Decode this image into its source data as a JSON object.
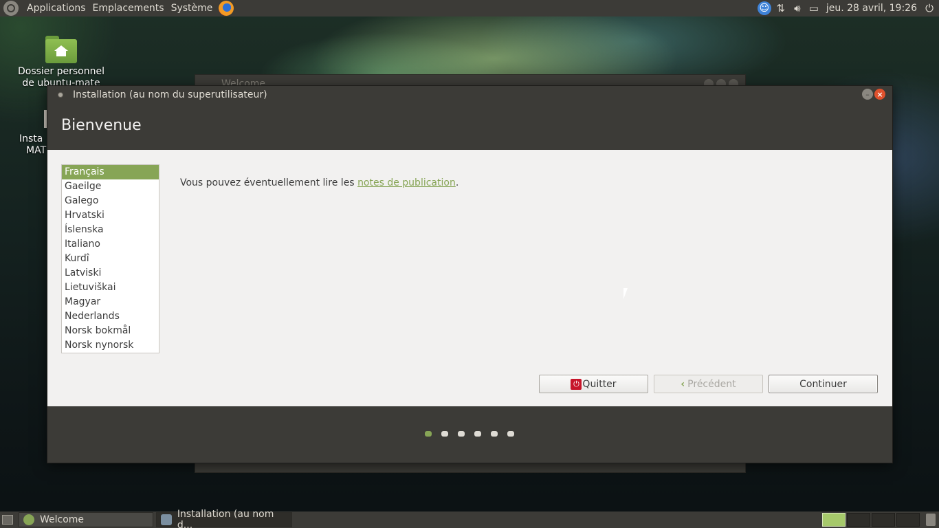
{
  "top_panel": {
    "menus": [
      "Applications",
      "Emplacements",
      "Système"
    ],
    "clock": "jeu. 28 avril, 19:26",
    "tray_icons": [
      "accessibility-icon",
      "network-icon",
      "volume-icon",
      "battery-icon",
      "power-icon"
    ]
  },
  "desktop": {
    "icons": [
      {
        "label_line1": "Dossier personnel",
        "label_line2": "de ubuntu-mate"
      },
      {
        "label_line1": "Insta",
        "label_line2": "MAT"
      }
    ]
  },
  "background_window": {
    "title": "Welcome"
  },
  "installer": {
    "window_title": "Installation (au nom du superutilisateur)",
    "heading": "Bienvenue",
    "languages": [
      "Français",
      "Gaeilge",
      "Galego",
      "Hrvatski",
      "Íslenska",
      "Italiano",
      "Kurdî",
      "Latviski",
      "Lietuviškai",
      "Magyar",
      "Nederlands",
      "Norsk bokmål",
      "Norsk nynorsk"
    ],
    "selected_language": "Français",
    "info_prefix": "Vous pouvez éventuellement lire les ",
    "info_link": "notes de publication",
    "info_suffix": ".",
    "buttons": {
      "quit": "Quitter",
      "previous": "Précédent",
      "continue": "Continuer"
    },
    "steps_total": 6,
    "current_step": 1
  },
  "bottom_panel": {
    "tasks": [
      "Welcome",
      "Installation (au nom d..."
    ]
  },
  "colors": {
    "accent": "#87a556",
    "panel": "#3c3b37",
    "window_bg": "#f2f1f0",
    "close_button": "#e0512d"
  }
}
